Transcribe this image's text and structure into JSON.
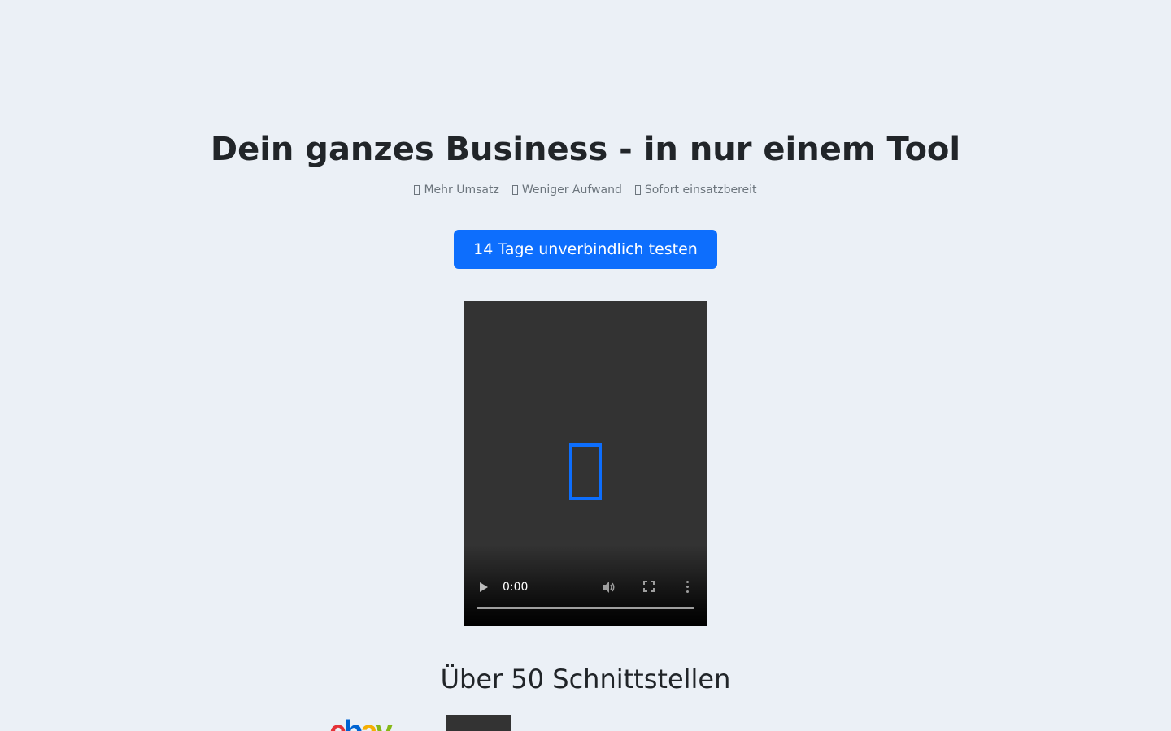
{
  "hero": {
    "headline": "Dein ganzes Business - in nur einem Tool",
    "benefits": [
      {
        "icon": "check-icon",
        "label": "Mehr Umsatz"
      },
      {
        "icon": "check-icon",
        "label": "Weniger Aufwand"
      },
      {
        "icon": "check-icon",
        "label": "Sofort einsatzbereit"
      }
    ],
    "cta_label": "14 Tage unverbindlich testen"
  },
  "video": {
    "current_time": "0:00",
    "progress": 0,
    "overlay_icon": "play-icon",
    "accent_color": "#0d6efd"
  },
  "integrations": {
    "title": "Über 50 Schnittstellen",
    "logos": [
      {
        "name": "ebay",
        "wordmark": "ebay"
      },
      {
        "name": "partner-logo",
        "wordmark": ""
      }
    ]
  },
  "colors": {
    "background": "#ebf0f6",
    "primary": "#0d6efd",
    "text": "#212529",
    "muted": "#6c757d"
  }
}
